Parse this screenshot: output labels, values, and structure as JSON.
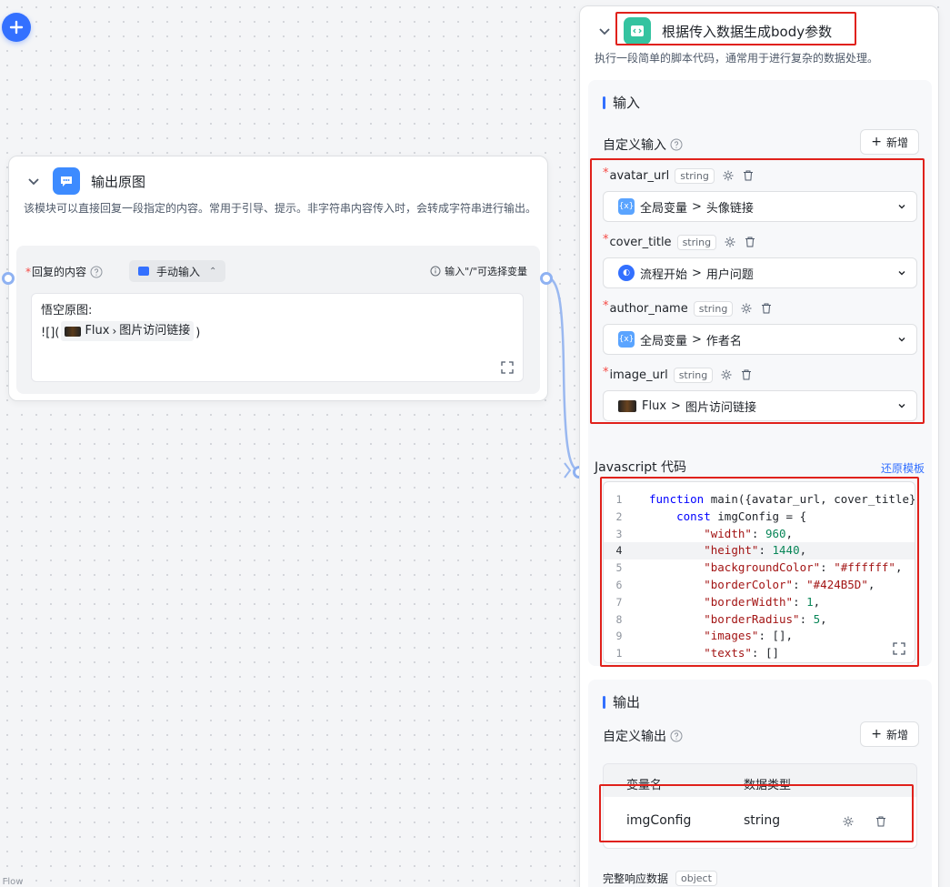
{
  "left_node": {
    "title": "输出原图",
    "description": "该模块可以直接回复一段指定的内容。常用于引导、提示。非字符串内容传入时，会转成字符串进行输出。",
    "reply_label": "回复的内容",
    "mode": "手动输入",
    "var_hint": "输入\"/\"可选择变量",
    "content_line1": "悟空原图:",
    "content_prefix": "![](",
    "chip_source": "Flux",
    "chip_field": "图片访问链接",
    "content_suffix": ")"
  },
  "right_node": {
    "title": "根据传入数据生成body参数",
    "description": "执行一段简单的脚本代码，通常用于进行复杂的数据处理。",
    "input_section": {
      "title": "输入",
      "custom_label": "自定义输入",
      "add_label": "新增",
      "items": [
        {
          "name": "avatar_url",
          "type": "string",
          "source": "全局变量",
          "field": "头像链接",
          "source_kind": "global"
        },
        {
          "name": "cover_title",
          "type": "string",
          "source": "流程开始",
          "field": "用户问题",
          "source_kind": "start"
        },
        {
          "name": "author_name",
          "type": "string",
          "source": "全局变量",
          "field": "作者名",
          "source_kind": "global"
        },
        {
          "name": "image_url",
          "type": "string",
          "source": "Flux",
          "field": "图片访问链接",
          "source_kind": "flux"
        }
      ]
    },
    "code": {
      "label": "Javascript 代码",
      "restore_label": "还原模板",
      "line_numbers": [
        "1",
        "2",
        "3",
        "4",
        "5",
        "6",
        "7",
        "8",
        "9",
        "1"
      ],
      "lines": [
        "function main({avatar_url, cover_title}",
        "    const imgConfig = {",
        "        \"width\": 960,",
        "        \"height\": 1440,",
        "        \"backgroundColor\": \"#ffffff\",",
        "        \"borderColor\": \"#424B5D\",",
        "        \"borderWidth\": 1,",
        "        \"borderRadius\": 5,",
        "        \"images\": [],",
        "        \"texts\": []"
      ]
    },
    "output_section": {
      "title": "输出",
      "custom_label": "自定义输出",
      "add_label": "新增",
      "col_name": "变量名",
      "col_type": "数据类型",
      "row_name": "imgConfig",
      "row_type": "string",
      "full_response_label": "完整响应数据",
      "full_response_type": "object"
    }
  },
  "footer": "ct Flow",
  "colors": {
    "accent": "#3370ff",
    "highlight": "#e0211b",
    "code_icon": "#34c3a0"
  }
}
